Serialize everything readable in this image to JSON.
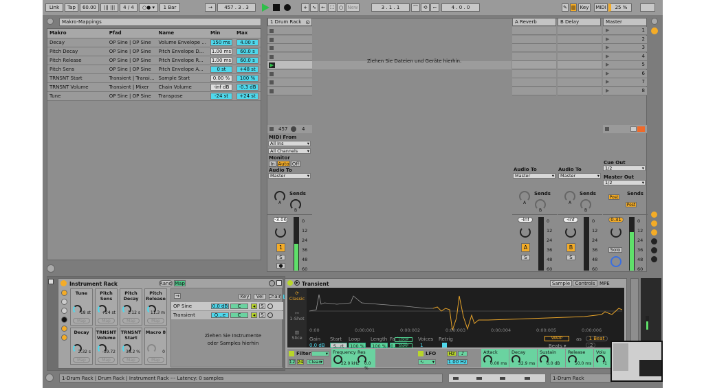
{
  "toolbar": {
    "link": "Link",
    "tap": "Tap",
    "tempo": "60.00",
    "signature": "4 / 4",
    "quantize": "1 Bar",
    "position": "457 .  3 .  3",
    "new": "New",
    "loop_start": "3 .  1 .  1",
    "loop_length": "4 .  0 .  0",
    "key": "Key",
    "midi": "MIDI",
    "cpu": "25 %"
  },
  "macro_mappings": {
    "title": "Makro-Mappings",
    "columns": [
      "Makro",
      "Pfad",
      "Name",
      "Min",
      "Max"
    ],
    "rows": [
      {
        "makro": "Decay",
        "pfad": "OP Sine | OP Sine",
        "name": "Volume Envelope ...",
        "min": "150 ms",
        "max": "4.00 s"
      },
      {
        "makro": "Pitch Decay",
        "pfad": "OP Sine | OP Sine",
        "name": "Pitch Envelope D...",
        "min": "1.00 ms",
        "max": "60.0 s"
      },
      {
        "makro": "Pitch Release",
        "pfad": "OP Sine | OP Sine",
        "name": "Pitch Envelope R...",
        "min": "1.00 ms",
        "max": "60.0 s"
      },
      {
        "makro": "Pitch Sens",
        "pfad": "OP Sine | OP Sine",
        "name": "Pitch Envelope A...",
        "min": "0 st",
        "max": "+48 st"
      },
      {
        "makro": "TRNSNT Start",
        "pfad": "Transient | Transi...",
        "name": "Sample Start",
        "min": "0.00 %",
        "max": "100 %"
      },
      {
        "makro": "TRNSNT Volume",
        "pfad": "Transient | Mixer",
        "name": "Chain Volume",
        "min": "-inf dB",
        "max": "-0.3 dB"
      },
      {
        "makro": "Tune",
        "pfad": "OP Sine | OP Sine",
        "name": "Transpose",
        "min": "-24 st",
        "max": "+24 st"
      }
    ]
  },
  "session": {
    "drop_hint": "Ziehen Sie Dateien und Geräte hierhin.",
    "tracks": [
      {
        "name": "1 Drum Rack"
      },
      {
        "name": "A Reverb"
      },
      {
        "name": "B Delay"
      },
      {
        "name": "Master"
      }
    ],
    "scenes": [
      "1",
      "2",
      "3",
      "4",
      "5",
      "6",
      "7",
      "8"
    ],
    "status_num": "457",
    "status_num2": "4"
  },
  "io": {
    "midi_from": "MIDI From",
    "all_ins": "All Ins",
    "all_channels": "All Channels",
    "monitor": "Monitor",
    "in": "In",
    "auto": "Auto",
    "off": "Off",
    "audio_to": "Audio To",
    "master": "Master",
    "cue_out": "Cue Out",
    "cue_val": "1/2",
    "master_out": "Master Out",
    "master_val": "1/2",
    "sends": "Sends",
    "post": "Post",
    "knob_a": "A",
    "knob_b": "B"
  },
  "mixer": {
    "track_vol": "-3.06",
    "a_vol": "-Inf",
    "b_vol": "-Inf",
    "master_vol": "0.31",
    "track_num": "1",
    "a": "A",
    "b": "B",
    "solo": "S",
    "solo_master": "Solo",
    "scale": [
      "0",
      "12",
      "24",
      "36",
      "48",
      "60"
    ],
    "track_meter": 0.5,
    "master_meter": 0.72
  },
  "rack": {
    "title": "Instrument Rack",
    "rand": "Rand",
    "map": "Map",
    "map_label": "Map",
    "macros": [
      {
        "name": "Tune",
        "value": "-18 st"
      },
      {
        "name": "Pitch Sens",
        "value": "+24 st"
      },
      {
        "name": "Pitch Decay",
        "value": "1.12 s"
      },
      {
        "name": "Pitch Release",
        "value": "11.3 m"
      },
      {
        "name": "Decay",
        "value": "2.32 s"
      },
      {
        "name": "TRNSNT Volume",
        "value": "-19.72"
      },
      {
        "name": "TRNSNT Start",
        "value": "36.2 %"
      },
      {
        "name": "Macro 8",
        "value": "0"
      }
    ],
    "chain_tabs": [
      "Key",
      "Vel",
      "Chain",
      "Hide"
    ],
    "chains": [
      {
        "name": "OP Sine",
        "vol": "0.0 dB",
        "pan": "C"
      },
      {
        "name": "Transient",
        "vol": "Ϙ...e",
        "pan": "C"
      }
    ],
    "solo": "S",
    "drop_hint": "Ziehen Sie Instrumente oder Samples hierhin"
  },
  "simpler": {
    "title": "Transient",
    "tabs": [
      "Sample",
      "Controls",
      "MPE"
    ],
    "modes": [
      "Classic",
      "1-Shot",
      "Slice"
    ],
    "time_ticks": [
      "0:00",
      "0:00:001",
      "0:00:002",
      "0:00:003",
      "0:00:004",
      "0:00:005",
      "0:00:006"
    ],
    "params": [
      {
        "label": "Gain",
        "value": "0.0 dB"
      },
      {
        "label": "Start",
        "value": "S...rt"
      },
      {
        "label": "Loop",
        "value": "100 %"
      },
      {
        "label": "Length",
        "value": "100 %"
      },
      {
        "label": "Fade",
        "value": "0.00 %"
      }
    ],
    "loop": "LOOP",
    "snap": "SNAP",
    "voices_label": "Voices",
    "voices": "1",
    "retrig": "Retrig",
    "warp": "WARP",
    "as": "as",
    "beat": "1 Beat",
    "beats": "Beats",
    "div": ":2",
    "filter": "Filter",
    "f12": "12",
    "f24": "24",
    "clean": "Clean",
    "frequency": "Frequency",
    "freq_val": "22.0 kHz",
    "res": "Res",
    "res_val": "0.0 %",
    "lfo": "LFO",
    "hz": "Hz",
    "lfo_rate": "1.00 Hz",
    "env": [
      {
        "label": "Attack",
        "value": "0.00 ms"
      },
      {
        "label": "Decay",
        "value": "32.9 ms"
      },
      {
        "label": "Sustain",
        "value": "0.0 dB"
      },
      {
        "label": "Release",
        "value": "50.0 ms"
      },
      {
        "label": "Volu",
        "value": "-1"
      }
    ]
  },
  "statusbar": {
    "text": "1-Drum Rack | Drum Rack | Instrument Rack --- Latency: 0 samples",
    "track": "1-Drum Rack"
  },
  "colors": {
    "accent": "#f4ac27",
    "cyan": "#4fd8ec",
    "play": "#2fbf4a",
    "waveform": "#e8a42a",
    "meter": "#5fe06a"
  }
}
